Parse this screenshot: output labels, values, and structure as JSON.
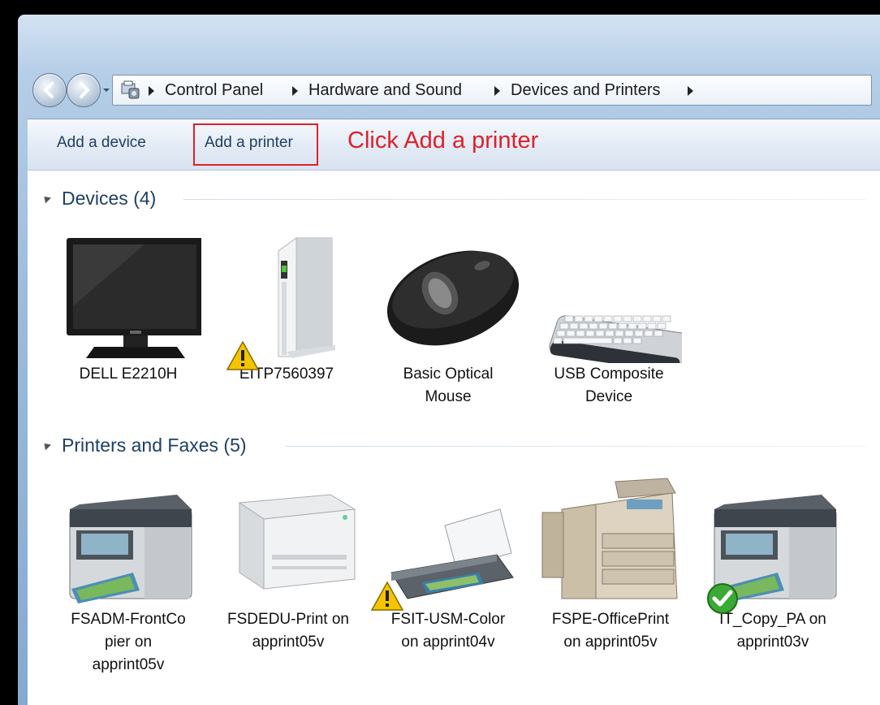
{
  "breadcrumb": {
    "items": [
      "Control Panel",
      "Hardware and Sound",
      "Devices and Printers"
    ]
  },
  "toolbar": {
    "add_device_label": "Add a device",
    "add_printer_label": "Add a printer",
    "annotation": "Click Add a printer"
  },
  "groups": {
    "devices": {
      "title": "Devices (4)",
      "items": [
        {
          "label_lines": [
            "DELL E2210H"
          ],
          "icon": "monitor-icon"
        },
        {
          "label_lines": [
            "EITP7560397"
          ],
          "icon": "computer-tower-icon",
          "warning": true
        },
        {
          "label_lines": [
            "Basic Optical",
            "Mouse"
          ],
          "icon": "mouse-icon"
        },
        {
          "label_lines": [
            "USB Composite",
            "Device"
          ],
          "icon": "keyboard-icon"
        }
      ]
    },
    "printers": {
      "title": "Printers and Faxes (5)",
      "items": [
        {
          "label_lines": [
            "FSADM-FrontCo",
            "pier on",
            "apprint05v"
          ],
          "icon": "multifunction-printer-icon"
        },
        {
          "label_lines": [
            "FSDEDU-Print on",
            "apprint05v"
          ],
          "icon": "laser-printer-icon"
        },
        {
          "label_lines": [
            "FSIT-USM-Color",
            "on apprint04v"
          ],
          "icon": "inkjet-printer-icon",
          "warning": true
        },
        {
          "label_lines": [
            "FSPE-OfficePrint",
            "on apprint05v"
          ],
          "icon": "office-copier-icon"
        },
        {
          "label_lines": [
            "IT_Copy_PA on",
            "apprint03v"
          ],
          "icon": "multifunction-printer-icon",
          "default": true
        }
      ]
    }
  },
  "colors": {
    "annotation": "#e0202a",
    "link": "#1e3f66"
  }
}
